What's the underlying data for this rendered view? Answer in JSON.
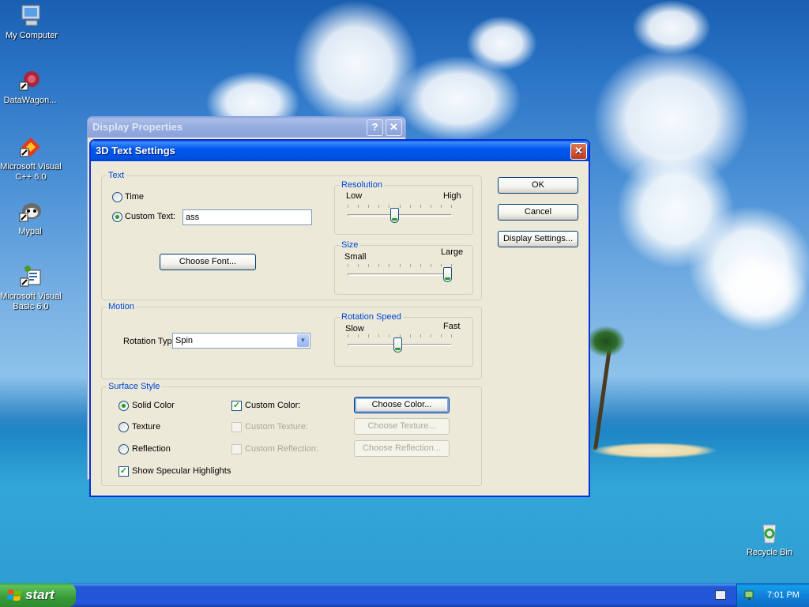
{
  "desktop": {
    "icons": [
      {
        "label": "My Computer"
      },
      {
        "label": "DataWagon..."
      },
      {
        "label": "Microsoft Visual C++ 6.0"
      },
      {
        "label": "Mypal"
      },
      {
        "label": "Microsoft Visual Basic 6.0"
      },
      {
        "label": "Recycle Bin"
      }
    ]
  },
  "back_window": {
    "title": "Display Properties",
    "help_glyph": "?",
    "close_glyph": "✕"
  },
  "dialog": {
    "title": "3D Text Settings",
    "close_glyph": "✕",
    "text_group": {
      "label": "Text",
      "time_label": "Time",
      "custom_text_label": "Custom Text:",
      "custom_text_value": "ass",
      "choose_font_label": "Choose Font...",
      "selected_option": "custom_text"
    },
    "resolution": {
      "label": "Resolution",
      "low": "Low",
      "high": "High",
      "value": 0.45
    },
    "size": {
      "label": "Size",
      "small": "Small",
      "large": "Large",
      "value": 1.0
    },
    "motion": {
      "label": "Motion",
      "rotation_type_label": "Rotation Type:",
      "rotation_type_value": "Spin"
    },
    "rotation_speed": {
      "label": "Rotation Speed",
      "slow": "Slow",
      "fast": "Fast",
      "value": 0.48
    },
    "surface": {
      "label": "Surface Style",
      "solid_color": "Solid Color",
      "texture": "Texture",
      "reflection": "Reflection",
      "custom_color": "Custom Color:",
      "custom_texture": "Custom Texture:",
      "custom_reflection": "Custom Reflection:",
      "choose_color": "Choose Color...",
      "choose_texture": "Choose Texture...",
      "choose_reflection": "Choose Reflection...",
      "specular": "Show Specular Highlights",
      "selected_style": "solid_color",
      "custom_color_checked": true,
      "specular_checked": true
    },
    "buttons": {
      "ok": "OK",
      "cancel": "Cancel",
      "display_settings": "Display Settings..."
    }
  },
  "taskbar": {
    "start_label": "start",
    "clock": "7:01 PM"
  },
  "colors": {
    "title_active": "#0058ee",
    "group_label": "#0046d5",
    "dialog_bg": "#ece9d8",
    "start_green": "#3a9a3a"
  }
}
